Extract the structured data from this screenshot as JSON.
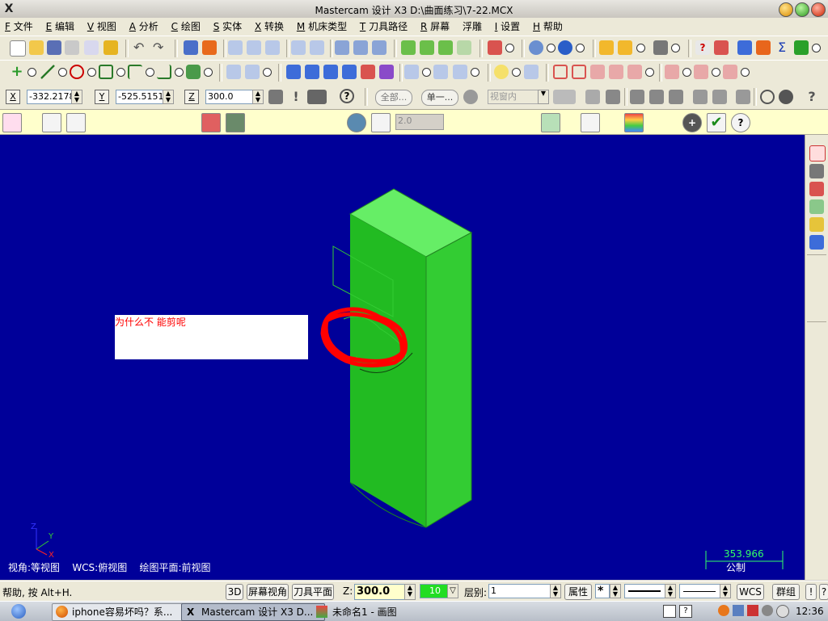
{
  "window": {
    "title": "Mastercam 设计 X3  D:\\曲面练习\\7-22.MCX"
  },
  "menu": [
    {
      "key": "F",
      "label": "文件"
    },
    {
      "key": "E",
      "label": "编辑"
    },
    {
      "key": "V",
      "label": "视图"
    },
    {
      "key": "A",
      "label": "分析"
    },
    {
      "key": "C",
      "label": "绘图"
    },
    {
      "key": "S",
      "label": "实体"
    },
    {
      "key": "X",
      "label": "转换"
    },
    {
      "key": "M",
      "label": "机床类型"
    },
    {
      "key": "T",
      "label": "刀具路径"
    },
    {
      "key": "R",
      "label": "屏幕"
    },
    {
      "key": "",
      "label": "浮雕"
    },
    {
      "key": "I",
      "label": "设置"
    },
    {
      "key": "H",
      "label": "帮助"
    }
  ],
  "coords": {
    "x_label": "X",
    "x_value": "-332.2178",
    "y_label": "Y",
    "y_value": "-525.5151",
    "z_label": "Z",
    "z_value": "300.0"
  },
  "selection": {
    "all_label": "全部...",
    "single_label": "单一...",
    "window_mode": "视窗内"
  },
  "ribbon": {
    "value": "2.0"
  },
  "viewport": {
    "annotation": "为什么不  能剪呢",
    "view_info": {
      "view": "视角:等视图",
      "wcs": "WCS:俯视图",
      "plane": "绘图平面:前视图"
    },
    "axis_labels": {
      "z": "Z",
      "y": "Y",
      "x": "X"
    },
    "scale_value": "353.966",
    "scale_unit": "公制"
  },
  "status": {
    "help_text": "帮助, 按 Alt+H.",
    "btn_3d": "3D",
    "btn_screen_view": "屏幕视角",
    "btn_tool_plane": "刀具平面",
    "z_label": "Z:",
    "z_value": "300.0",
    "color_value": "10",
    "level_label": "层别:",
    "level_value": "1",
    "btn_attributes": "属性",
    "point_style": "*",
    "btn_wcs": "WCS",
    "btn_group": "群组",
    "btn_excl": "!",
    "btn_q": "?"
  },
  "taskbar": {
    "tasks": [
      {
        "label": "iphone容易坏吗？系...",
        "active": false
      },
      {
        "label": "Mastercam 设计 X3  D...",
        "active": true
      },
      {
        "label": "未命名1 - 画图",
        "active": false
      }
    ],
    "clock": "12:36"
  },
  "colors": {
    "viewport_bg": "#000099",
    "solid_green": "#33cc33",
    "annotation_red": "#ff0000",
    "scale_green": "#33ff66"
  }
}
